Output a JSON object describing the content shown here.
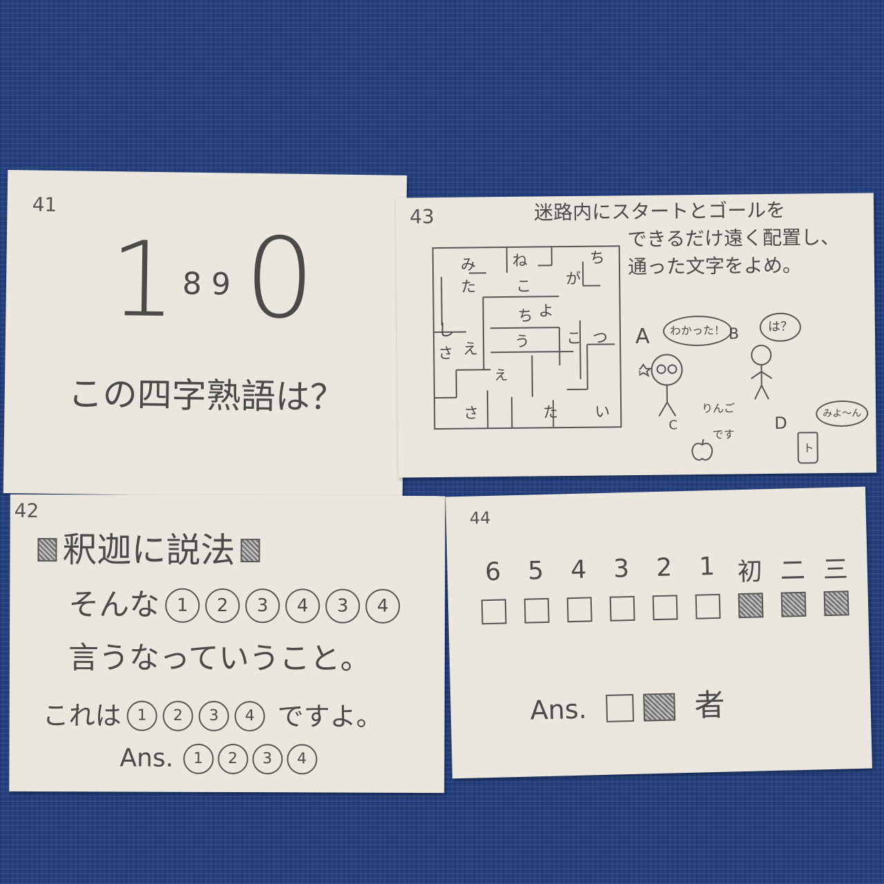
{
  "card41": {
    "number": "41",
    "digit_1": "1",
    "digits_89": "8 9",
    "digit_0": "0",
    "question": "この四字熟語は？"
  },
  "card42": {
    "number": "42",
    "line1": "釈迦に説法",
    "line2_prefix": "そんな",
    "line2_circles": [
      "1",
      "2",
      "3",
      "4",
      "3",
      "4"
    ],
    "line3": "言うなっていうこと。",
    "line4_prefix": "これは",
    "line4_circles": [
      "1",
      "2",
      "3",
      "4"
    ],
    "line4_suffix": "ですよ。",
    "ans_label": "Ans.",
    "ans_circles": [
      "1",
      "2",
      "3",
      "4"
    ]
  },
  "card43": {
    "number": "43",
    "instruction_line1": "迷路内にスタートとゴールを",
    "instruction_line2": "できるだけ遠く配置し、",
    "instruction_line3": "通った文字をよめ。",
    "maze_chars": [
      "み",
      "ね",
      "ち",
      "た",
      "こ",
      "が",
      "ち",
      "よ",
      "し",
      "さ",
      "え",
      "う",
      "こ",
      "つ",
      "え",
      "さ",
      "た",
      "い"
    ],
    "char_a": {
      "label": "A",
      "speech": "わかった！"
    },
    "char_b": {
      "label": "B",
      "speech": "は？"
    },
    "char_c": {
      "label": "C",
      "speech_line1": "りんご",
      "speech_line2": "です"
    },
    "char_d": {
      "label": "D",
      "speech": "みよ〜ん",
      "cup_mark": "ト"
    }
  },
  "card44": {
    "number": "44",
    "headers": [
      "6",
      "5",
      "4",
      "3",
      "2",
      "1",
      "初",
      "二",
      "三"
    ],
    "hatched": [
      false,
      false,
      false,
      false,
      false,
      false,
      true,
      true,
      true
    ],
    "ans_label": "Ans.",
    "ans_suffix": "者"
  }
}
